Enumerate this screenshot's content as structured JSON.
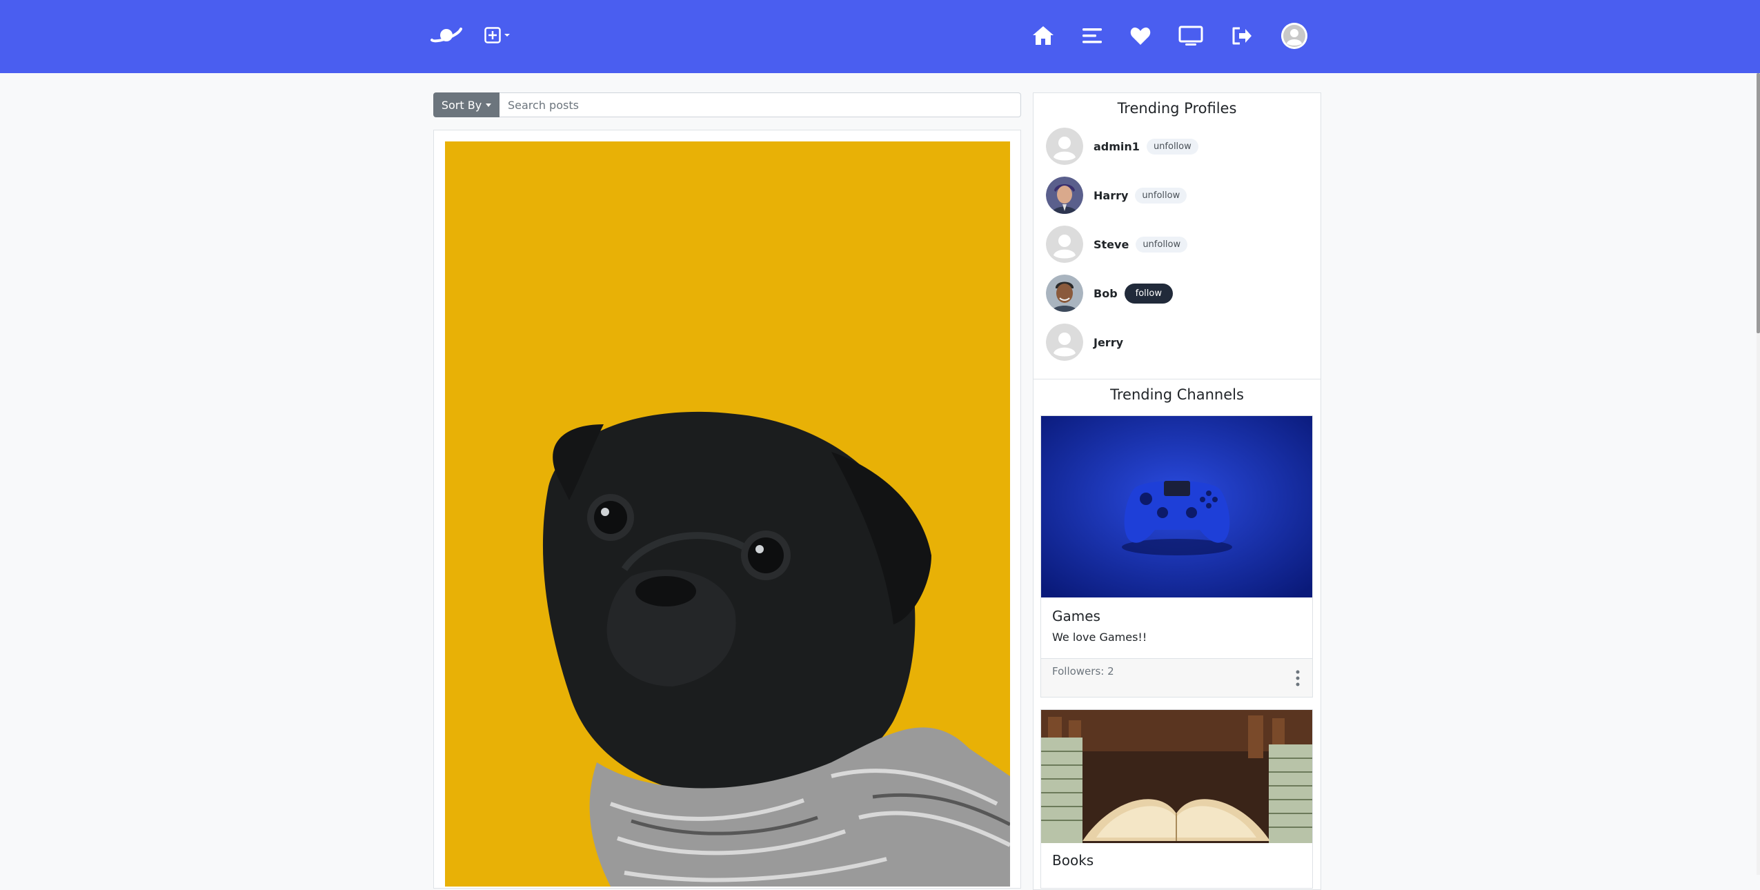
{
  "nav": {
    "brand_icon": "planet-icon",
    "create_icon": "plus-square-icon",
    "items": [
      {
        "icon": "home-icon"
      },
      {
        "icon": "list-icon"
      },
      {
        "icon": "heart-icon"
      },
      {
        "icon": "monitor-icon"
      },
      {
        "icon": "logout-icon"
      },
      {
        "icon": "user-avatar-icon"
      }
    ],
    "bg_color": "#4a5ef0"
  },
  "search": {
    "sort_label": "Sort By",
    "placeholder": "Search posts",
    "value": ""
  },
  "post": {
    "image_desc_color": "#e8b106"
  },
  "trending_profiles": {
    "title": "Trending Profiles",
    "profiles": [
      {
        "name": "admin1",
        "action": "unfollow",
        "avatar": "default"
      },
      {
        "name": "Harry",
        "action": "unfollow",
        "avatar": "photo"
      },
      {
        "name": "Steve",
        "action": "unfollow",
        "avatar": "default"
      },
      {
        "name": "Bob",
        "action": "follow",
        "avatar": "photo"
      },
      {
        "name": "Jerry",
        "action": "",
        "avatar": "default"
      }
    ]
  },
  "trending_channels": {
    "title": "Trending Channels",
    "channels": [
      {
        "name": "Games",
        "description": "We love Games!!",
        "followers": "Followers: 2"
      },
      {
        "name": "Books",
        "description": "",
        "followers": ""
      }
    ]
  }
}
